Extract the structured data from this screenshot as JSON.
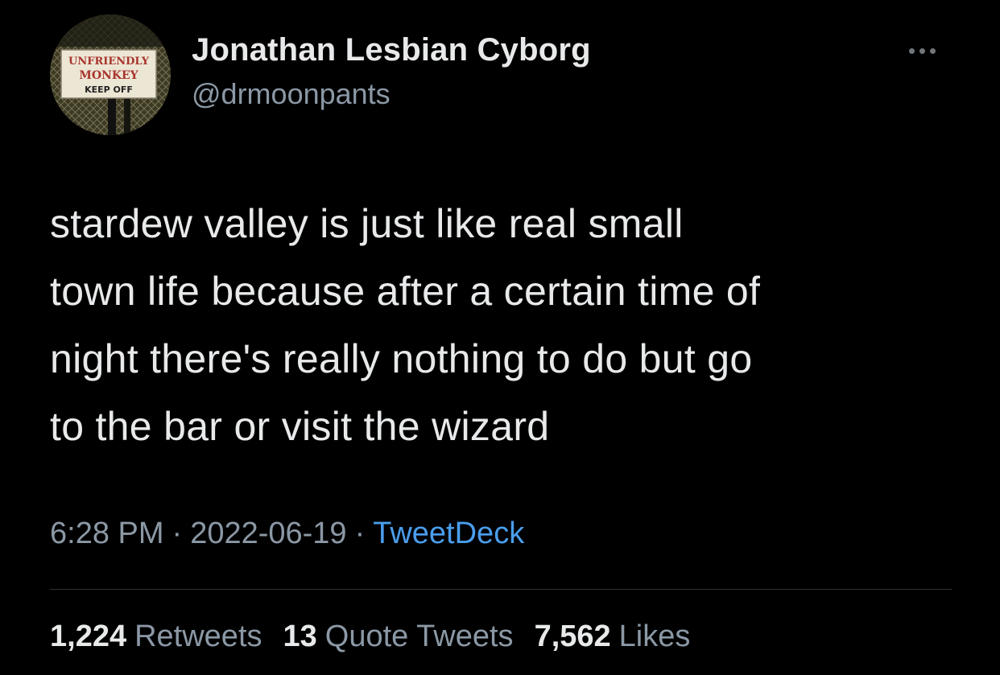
{
  "author": {
    "display_name": "Jonathan Lesbian Cyborg",
    "handle": "@drmoonpants",
    "avatar": {
      "sign_line1": "UNFRIENDLY",
      "sign_line2": "MONKEY",
      "sign_line3": "KEEP OFF"
    }
  },
  "tweet": {
    "lines": [
      "stardew valley is just like real small",
      "town life because after a certain time of",
      "night there's really nothing to do but go",
      "to the bar or visit the wizard"
    ]
  },
  "meta": {
    "time": "6:28 PM",
    "separator": "·",
    "date": "2022-06-19",
    "source": "TweetDeck"
  },
  "stats": {
    "retweets_count": "1,224",
    "retweets_label": "Retweets",
    "quotes_count": "13",
    "quotes_label": "Quote Tweets",
    "likes_count": "7,562",
    "likes_label": "Likes"
  },
  "colors": {
    "background": "#000000",
    "primary_text": "#e7e9ea",
    "secondary_text": "#8b98a5",
    "link": "#4a9eed",
    "divider": "#2f3336"
  },
  "icons": {
    "more": "more-dots-icon"
  }
}
